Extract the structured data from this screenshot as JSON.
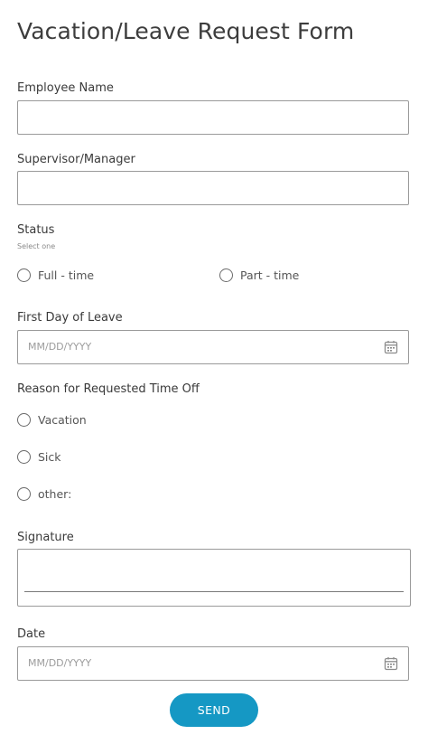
{
  "form": {
    "title": "Vacation/Leave Request Form",
    "employee_name": {
      "label": "Employee Name",
      "value": ""
    },
    "supervisor": {
      "label": "Supervisor/Manager",
      "value": ""
    },
    "status": {
      "label": "Status",
      "hint": "Select one",
      "options": [
        "Full - time",
        "Part - time"
      ]
    },
    "first_day": {
      "label": "First Day of Leave",
      "placeholder": "MM/DD/YYYY"
    },
    "reason": {
      "label": "Reason for Requested Time Off",
      "options": [
        "Vacation",
        "Sick",
        "other:"
      ]
    },
    "signature": {
      "label": "Signature"
    },
    "date": {
      "label": "Date",
      "placeholder": "MM/DD/YYYY"
    },
    "submit_label": "SEND"
  },
  "icons": {
    "date_picker": "calendar-icon"
  },
  "colors": {
    "accent": "#1598c4",
    "border": "#9a9a9a",
    "text": "#3a3a3a",
    "placeholder": "#9c9c9c"
  }
}
